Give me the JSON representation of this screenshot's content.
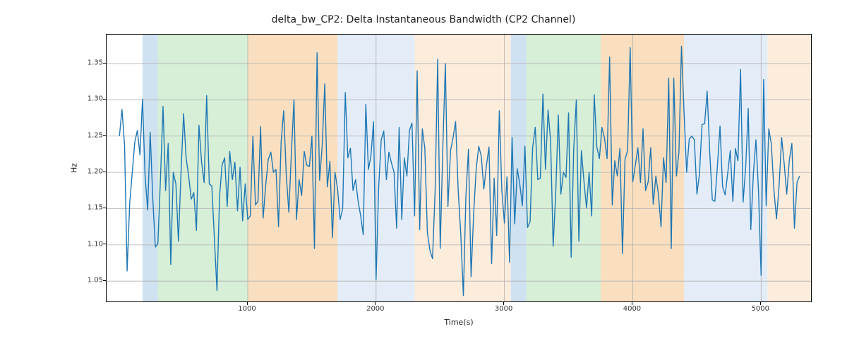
{
  "chart_data": {
    "type": "line",
    "title": "delta_bw_CP2: Delta Instantaneous Bandwidth (CP2 Channel)",
    "xlabel": "Time(s)",
    "ylabel": "Hz",
    "xlim": [
      -100,
      5400
    ],
    "ylim": [
      1.02,
      1.39
    ],
    "xticks": [
      1000,
      2000,
      3000,
      4000,
      5000
    ],
    "yticks": [
      1.05,
      1.1,
      1.15,
      1.2,
      1.25,
      1.3,
      1.35
    ],
    "bands": [
      {
        "x0": 180,
        "x1": 300,
        "color": "#a8cbe6",
        "alpha": 0.55
      },
      {
        "x0": 300,
        "x1": 1000,
        "color": "#b7e0b7",
        "alpha": 0.55
      },
      {
        "x0": 1000,
        "x1": 1700,
        "color": "#f4c48b",
        "alpha": 0.55
      },
      {
        "x0": 1700,
        "x1": 2300,
        "color": "#cddff0",
        "alpha": 0.55
      },
      {
        "x0": 2300,
        "x1": 3050,
        "color": "#f9ddbf",
        "alpha": 0.55
      },
      {
        "x0": 3050,
        "x1": 3170,
        "color": "#a8cbe6",
        "alpha": 0.55
      },
      {
        "x0": 3170,
        "x1": 3750,
        "color": "#b7e0b7",
        "alpha": 0.55
      },
      {
        "x0": 3750,
        "x1": 4400,
        "color": "#f4c48b",
        "alpha": 0.55
      },
      {
        "x0": 4400,
        "x1": 5050,
        "color": "#cddff0",
        "alpha": 0.55
      },
      {
        "x0": 5050,
        "x1": 5400,
        "color": "#f9ddbf",
        "alpha": 0.55
      }
    ],
    "x": [
      0,
      20,
      40,
      60,
      80,
      100,
      120,
      140,
      160,
      180,
      200,
      220,
      240,
      260,
      280,
      300,
      320,
      340,
      360,
      380,
      400,
      420,
      440,
      460,
      480,
      500,
      520,
      540,
      560,
      580,
      600,
      620,
      640,
      660,
      680,
      700,
      720,
      740,
      760,
      780,
      800,
      820,
      840,
      860,
      880,
      900,
      920,
      940,
      960,
      980,
      1000,
      1020,
      1040,
      1060,
      1080,
      1100,
      1120,
      1140,
      1160,
      1180,
      1200,
      1220,
      1240,
      1260,
      1280,
      1300,
      1320,
      1340,
      1360,
      1380,
      1400,
      1420,
      1440,
      1460,
      1480,
      1500,
      1520,
      1540,
      1560,
      1580,
      1600,
      1620,
      1640,
      1660,
      1680,
      1700,
      1720,
      1740,
      1760,
      1780,
      1800,
      1820,
      1840,
      1860,
      1880,
      1900,
      1920,
      1940,
      1960,
      1980,
      2000,
      2020,
      2040,
      2060,
      2080,
      2100,
      2120,
      2140,
      2160,
      2180,
      2200,
      2220,
      2240,
      2260,
      2280,
      2300,
      2320,
      2340,
      2360,
      2380,
      2400,
      2420,
      2440,
      2460,
      2480,
      2500,
      2520,
      2540,
      2560,
      2580,
      2600,
      2620,
      2640,
      2660,
      2680,
      2700,
      2720,
      2740,
      2760,
      2780,
      2800,
      2820,
      2840,
      2860,
      2880,
      2900,
      2920,
      2940,
      2960,
      2980,
      3000,
      3020,
      3040,
      3060,
      3080,
      3100,
      3120,
      3140,
      3160,
      3180,
      3200,
      3220,
      3240,
      3260,
      3280,
      3300,
      3320,
      3340,
      3360,
      3380,
      3400,
      3420,
      3440,
      3460,
      3480,
      3500,
      3520,
      3540,
      3560,
      3580,
      3600,
      3620,
      3640,
      3660,
      3680,
      3700,
      3720,
      3740,
      3760,
      3780,
      3800,
      3820,
      3840,
      3860,
      3880,
      3900,
      3920,
      3940,
      3960,
      3980,
      4000,
      4020,
      4040,
      4060,
      4080,
      4100,
      4120,
      4140,
      4160,
      4180,
      4200,
      4220,
      4240,
      4260,
      4280,
      4300,
      4320,
      4340,
      4360,
      4380,
      4400,
      4420,
      4440,
      4460,
      4480,
      4500,
      4520,
      4540,
      4560,
      4580,
      4600,
      4620,
      4640,
      4660,
      4680,
      4700,
      4720,
      4740,
      4760,
      4780,
      4800,
      4820,
      4840,
      4860,
      4880,
      4900,
      4920,
      4940,
      4960,
      4980,
      5000,
      5020,
      5040,
      5060,
      5080,
      5100,
      5120,
      5140,
      5160,
      5180,
      5200,
      5220,
      5240,
      5260,
      5280,
      5300
    ],
    "values": [
      1.25,
      1.287,
      1.237,
      1.064,
      1.157,
      1.2,
      1.242,
      1.258,
      1.224,
      1.301,
      1.196,
      1.148,
      1.255,
      1.163,
      1.097,
      1.102,
      1.193,
      1.291,
      1.175,
      1.24,
      1.073,
      1.2,
      1.184,
      1.105,
      1.201,
      1.281,
      1.22,
      1.194,
      1.163,
      1.172,
      1.12,
      1.265,
      1.215,
      1.186,
      1.306,
      1.184,
      1.181,
      1.11,
      1.037,
      1.166,
      1.21,
      1.22,
      1.153,
      1.229,
      1.19,
      1.214,
      1.147,
      1.207,
      1.133,
      1.184,
      1.135,
      1.14,
      1.25,
      1.155,
      1.16,
      1.263,
      1.137,
      1.183,
      1.218,
      1.228,
      1.2,
      1.204,
      1.125,
      1.242,
      1.285,
      1.198,
      1.145,
      1.226,
      1.3,
      1.135,
      1.19,
      1.168,
      1.229,
      1.21,
      1.208,
      1.25,
      1.095,
      1.365,
      1.189,
      1.237,
      1.322,
      1.18,
      1.215,
      1.11,
      1.2,
      1.177,
      1.135,
      1.15,
      1.31,
      1.22,
      1.233,
      1.175,
      1.19,
      1.16,
      1.14,
      1.114,
      1.294,
      1.204,
      1.222,
      1.27,
      1.052,
      1.18,
      1.245,
      1.257,
      1.19,
      1.228,
      1.213,
      1.2,
      1.123,
      1.262,
      1.135,
      1.22,
      1.195,
      1.258,
      1.268,
      1.14,
      1.34,
      1.121,
      1.26,
      1.233,
      1.117,
      1.092,
      1.081,
      1.175,
      1.356,
      1.095,
      1.235,
      1.35,
      1.153,
      1.23,
      1.248,
      1.27,
      1.174,
      1.115,
      1.03,
      1.168,
      1.232,
      1.056,
      1.142,
      1.204,
      1.236,
      1.222,
      1.177,
      1.21,
      1.235,
      1.074,
      1.192,
      1.113,
      1.285,
      1.175,
      1.13,
      1.194,
      1.076,
      1.248,
      1.129,
      1.205,
      1.183,
      1.154,
      1.236,
      1.124,
      1.132,
      1.234,
      1.262,
      1.19,
      1.192,
      1.308,
      1.204,
      1.286,
      1.243,
      1.098,
      1.173,
      1.279,
      1.17,
      1.2,
      1.193,
      1.282,
      1.083,
      1.232,
      1.3,
      1.105,
      1.23,
      1.187,
      1.151,
      1.2,
      1.14,
      1.307,
      1.235,
      1.219,
      1.262,
      1.247,
      1.219,
      1.359,
      1.155,
      1.216,
      1.195,
      1.233,
      1.088,
      1.218,
      1.23,
      1.372,
      1.187,
      1.21,
      1.234,
      1.186,
      1.26,
      1.175,
      1.187,
      1.234,
      1.156,
      1.195,
      1.17,
      1.125,
      1.22,
      1.186,
      1.33,
      1.095,
      1.33,
      1.195,
      1.228,
      1.374,
      1.281,
      1.2,
      1.246,
      1.25,
      1.245,
      1.17,
      1.198,
      1.266,
      1.267,
      1.312,
      1.228,
      1.162,
      1.16,
      1.21,
      1.264,
      1.18,
      1.169,
      1.199,
      1.23,
      1.16,
      1.233,
      1.216,
      1.342,
      1.159,
      1.208,
      1.288,
      1.121,
      1.199,
      1.245,
      1.175,
      1.058,
      1.328,
      1.154,
      1.26,
      1.239,
      1.175,
      1.136,
      1.18,
      1.248,
      1.212,
      1.17,
      1.217,
      1.24,
      1.123,
      1.186,
      1.195
    ]
  }
}
